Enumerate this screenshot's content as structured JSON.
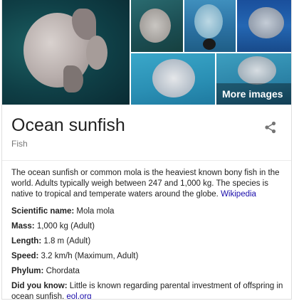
{
  "images": {
    "more_label": "More images"
  },
  "entity": {
    "title": "Ocean sunfish",
    "subtitle": "Fish"
  },
  "description": {
    "text": "The ocean sunfish or common mola is the heaviest known bony fish in the world. Adults typically weigh between 247 and 1,000 kg. The species is native to tropical and temperate waters around the globe.",
    "source": "Wikipedia"
  },
  "facts": [
    {
      "label": "Scientific name:",
      "value": "Mola mola"
    },
    {
      "label": "Mass:",
      "value": "1,000 kg (Adult)"
    },
    {
      "label": "Length:",
      "value": "1.8 m (Adult)"
    },
    {
      "label": "Speed:",
      "value": "3.2 km/h (Maximum, Adult)"
    },
    {
      "label": "Phylum:",
      "value": "Chordata"
    }
  ],
  "did_you_know": {
    "label": "Did you know:",
    "text": "Little is known regarding parental investment of offspring in ocean sunfish.",
    "source": "eol.org"
  },
  "icons": {
    "share": "share-icon"
  }
}
